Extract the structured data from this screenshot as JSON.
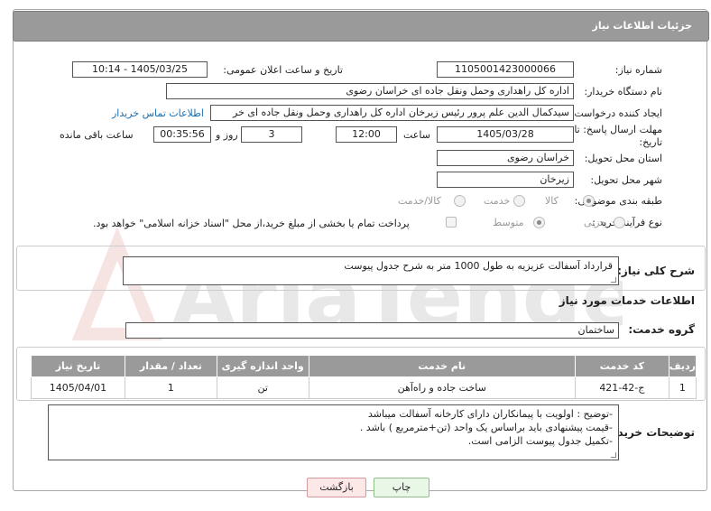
{
  "header": {
    "title": "جزئیات اطلاعات نیاز"
  },
  "fields": {
    "need_number_label": "شماره نیاز:",
    "need_number": "1105001423000066",
    "announce_label": "تاریخ و ساعت اعلان عمومی:",
    "announce_value": "1405/03/25 - 10:14",
    "buyer_label": "نام دستگاه خریدار:",
    "buyer_value": "اداره کل راهداری وحمل ونقل جاده ای خراسان رضوی",
    "creator_label": "ایجاد کننده درخواست:",
    "creator_value": "سیدکمال الدین علم پرور رئیس زیرخان اداره کل راهداری وحمل ونقل جاده ای خر",
    "contact_link": "اطلاعات تماس خریدار",
    "deadline_label": "مهلت ارسال پاسخ: تا تاریخ:",
    "deadline_date": "1405/03/28",
    "time_label": "ساعت",
    "deadline_time": "12:00",
    "days_value": "3",
    "days_label": "روز و",
    "remaining_value": "00:35:56",
    "remaining_label": "ساعت باقی مانده",
    "province_label": "استان محل تحویل:",
    "province_value": "خراسان رضوی",
    "city_label": "شهر محل تحویل:",
    "city_value": "زیرخان",
    "category_label": "طبقه بندی موضوعی:",
    "category_options": [
      "کالا",
      "خدمت",
      "کالا/خدمت"
    ],
    "purchase_label": "نوع فرآیند خرید :",
    "purchase_options": [
      "جزیی",
      "متوسط"
    ],
    "payment_note": "پرداخت تمام یا بخشی از مبلغ خرید،از محل \"اسناد خزانه اسلامی\" خواهد بود."
  },
  "description": {
    "label": "شرح کلی نیاز:",
    "value": "قرارداد آسفالت عزیزیه به طول 1000 متر به شرح جدول پیوست"
  },
  "services": {
    "section_title": "اطلاعات خدمات مورد نیاز",
    "group_label": "گروه خدمت:",
    "group_value": "ساختمان",
    "columns": [
      "ردیف",
      "کد خدمت",
      "نام خدمت",
      "واحد اندازه گیری",
      "تعداد / مقدار",
      "تاریخ نیاز"
    ],
    "rows": [
      {
        "row": "1",
        "code": "ج-42-421",
        "name": "ساخت جاده و راه‌آهن",
        "unit": "تن",
        "qty": "1",
        "date": "1405/04/01"
      }
    ]
  },
  "buyer_notes": {
    "label": "توضیحات خریدار:",
    "lines": [
      "-توضیح : اولویت با پیمانکاران دارای کارخانه آسفالت میباشد",
      "-قیمت پیشنهادی باید  براساس یک واحد (تن+مترمربع ) باشد .",
      "-تکمیل جدول پیوست الزامی است."
    ]
  },
  "buttons": {
    "print": "چاپ",
    "back": "بازگشت"
  },
  "watermark": {
    "text": "AriaTender.neT"
  },
  "colors": {
    "title_bar": "#9a9a9a",
    "link": "#1a6fb3",
    "print_bg": "#e9f7e6",
    "back_bg": "#fde8e8"
  }
}
